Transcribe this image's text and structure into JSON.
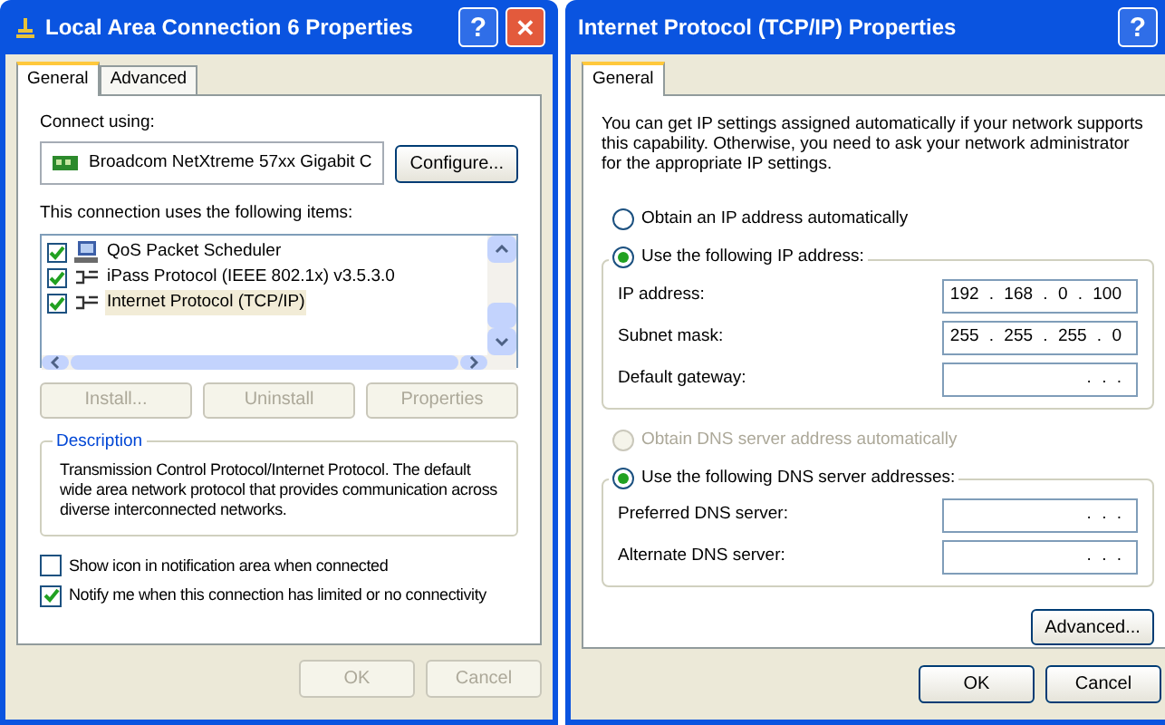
{
  "left_window": {
    "title": "Local Area Connection 6 Properties",
    "help_button": "?",
    "close_button": "✕",
    "tabs": [
      {
        "label": "General",
        "selected": true
      },
      {
        "label": "Advanced",
        "selected": false
      }
    ],
    "connect_using_label": "Connect using:",
    "adapter": "Broadcom NetXtreme 57xx Gigabit C",
    "configure_button": "Configure...",
    "items_label": "This connection uses the following items:",
    "items": [
      {
        "label": "QoS Packet Scheduler",
        "kind": "service",
        "checked": true,
        "selected": false
      },
      {
        "label": "iPass Protocol (IEEE 802.1x) v3.5.3.0",
        "kind": "protocol",
        "checked": true,
        "selected": false
      },
      {
        "label": "Internet Protocol (TCP/IP)",
        "kind": "protocol",
        "checked": true,
        "selected": true
      }
    ],
    "item_buttons": [
      {
        "label": "Install...",
        "disabled": true
      },
      {
        "label": "Uninstall",
        "disabled": true
      },
      {
        "label": "Properties",
        "disabled": true
      }
    ],
    "description": {
      "title": "Description",
      "text": "Transmission Control Protocol/Internet Protocol. The default wide area network protocol that provides communication across diverse interconnected networks."
    },
    "options": [
      {
        "label": "Show icon in notification area when connected",
        "checked": false
      },
      {
        "label": "Notify me when this connection has limited or no connectivity",
        "checked": true
      }
    ],
    "buttons": [
      {
        "label": "OK",
        "disabled": true
      },
      {
        "label": "Cancel",
        "disabled": true
      }
    ]
  },
  "right_window": {
    "title": "Internet Protocol (TCP/IP) Properties",
    "help_button": "?",
    "tabs": [
      {
        "label": "General",
        "selected": true
      }
    ],
    "intro": "You can get IP settings assigned automatically if your network supports this capability. Otherwise, you need to ask your network administrator for the appropriate IP settings.",
    "ip_options": [
      {
        "label": "Obtain an IP address automatically",
        "selected": false,
        "disabled": false
      },
      {
        "label": "Use the following IP address:",
        "selected": true,
        "disabled": false
      }
    ],
    "ip_fields": [
      {
        "label": "IP address:",
        "value": "192 . 168 . 0 . 100"
      },
      {
        "label": "Subnet mask:",
        "value": "255 . 255 . 255 . 0"
      },
      {
        "label": "Default gateway:",
        "value": ". . ."
      }
    ],
    "dns_options": [
      {
        "label": "Obtain DNS server address automatically",
        "selected": false,
        "disabled": true
      },
      {
        "label": "Use the following DNS server addresses:",
        "selected": true,
        "disabled": false
      }
    ],
    "dns_fields": [
      {
        "label": "Preferred DNS server:",
        "value": ". . ."
      },
      {
        "label": "Alternate DNS server:",
        "value": ". . ."
      }
    ],
    "advanced_button": "Advanced...",
    "buttons": [
      {
        "label": "OK",
        "disabled": false
      },
      {
        "label": "Cancel",
        "disabled": false
      }
    ]
  }
}
